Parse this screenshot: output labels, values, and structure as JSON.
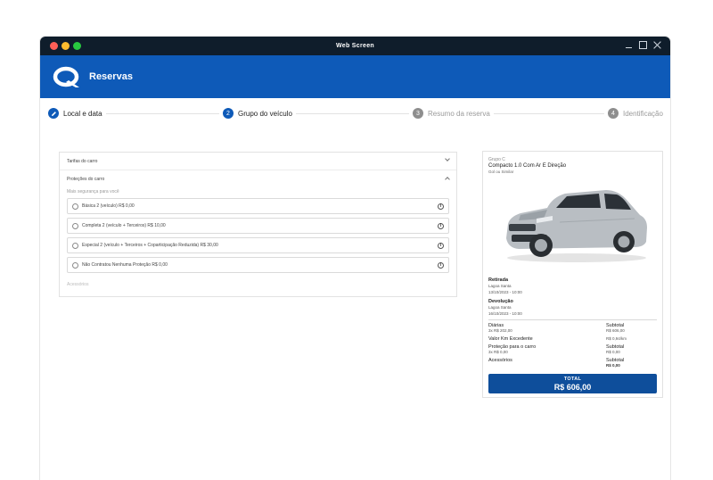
{
  "window": {
    "title": "Web Screen"
  },
  "header": {
    "title": "Reservas"
  },
  "steps": [
    {
      "num": "",
      "label": "Local e data"
    },
    {
      "num": "2",
      "label": "Grupo do veículo"
    },
    {
      "num": "3",
      "label": "Resumo da reserva"
    },
    {
      "num": "4",
      "label": "Identificação"
    }
  ],
  "left": {
    "tarifas": "Tarifas do carro",
    "protecoes": "Proteções do carro",
    "subtitle": "Mais segurança para você",
    "options": [
      "Básica 2 (veículo) R$ 0,00",
      "Completa 2 (veículo + Terceiros) R$ 10,00",
      "Especial 2 (veículo + Terceiros + Coparticipação Reduzida) R$ 30,00",
      "Não Contratou Nenhuma Proteção R$ 0,00"
    ],
    "acessorios": "Acessórios"
  },
  "summary": {
    "group": "Grupo C",
    "car_name": "Compacto 1.0 Com Ar E Direção",
    "car_sub": "Gol ou Similar",
    "retirada_title": "Retirada",
    "retirada_local": "Lagoa Santa",
    "retirada_date": "13/10/2023 - 10:00",
    "devolucao_title": "Devolução",
    "devolucao_local": "Lagoa Santa",
    "devolucao_date": "16/10/2023 - 10:00",
    "diarias_title": "Diárias",
    "diarias_detail": "3x R$ 202,00",
    "diarias_sub_label": "Subtotal",
    "diarias_sub_value": "R$ 606,00",
    "km_title": "Valor Km Excedente",
    "km_value": "R$ 0,94/km",
    "protecao_title": "Proteção para o carro",
    "protecao_detail": "3x R$ 0,00",
    "protecao_sub_label": "Subtotal",
    "protecao_sub_value": "R$ 0,00",
    "acessorios_title": "Acessórios",
    "acessorios_sub_label": "Subtotal",
    "acessorios_sub_value": "R$ 0,00",
    "total_label": "TOTAL",
    "total_value": "R$ 606,00"
  },
  "colors": {
    "brand": "#0e5ab8",
    "total_bg": "#0e4e9b",
    "titlebar": "#0f1d2b"
  }
}
